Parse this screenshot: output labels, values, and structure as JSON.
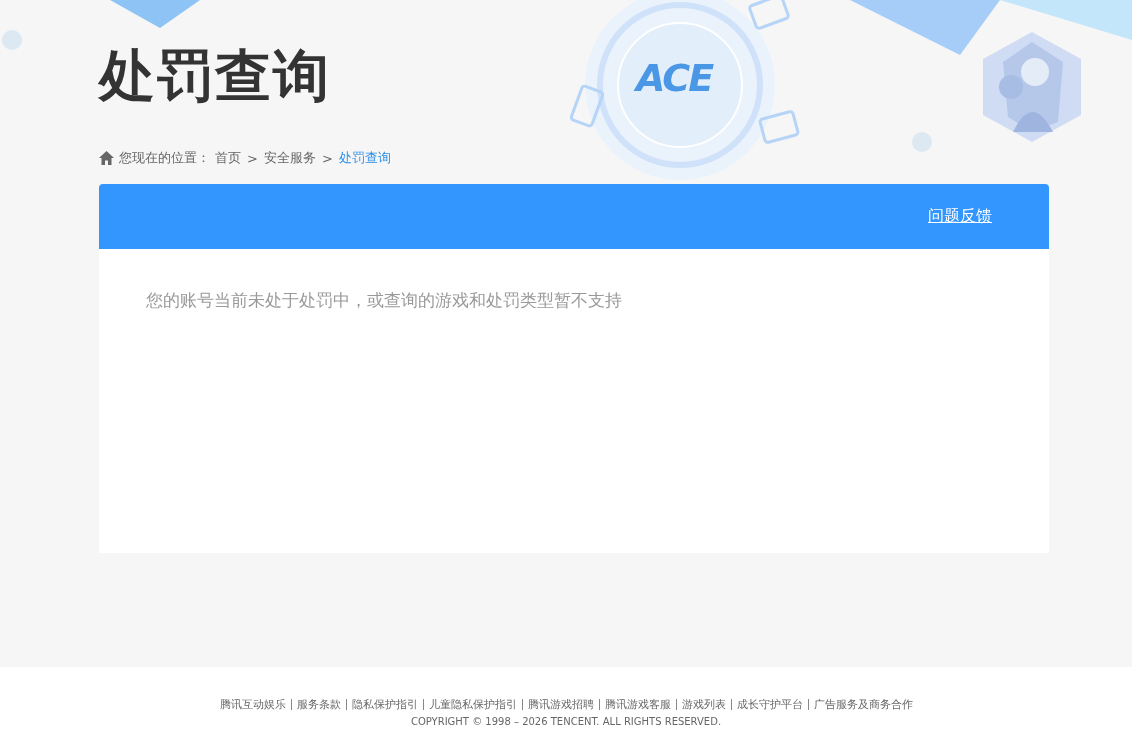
{
  "header": {
    "title": "处罚查询",
    "logo_text": "ACE"
  },
  "breadcrumb": {
    "prefix": "您现在的位置：",
    "items": [
      {
        "label": "首页",
        "selected": false
      },
      {
        "label": "安全服务",
        "selected": false
      },
      {
        "label": "处罚查询",
        "selected": true
      }
    ],
    "separator": ">"
  },
  "panel": {
    "feedback_link": "问题反馈",
    "message": "您的账号当前未处于处罚中，或查询的游戏和处罚类型暂不支持"
  },
  "footer": {
    "links": [
      "腾讯互动娱乐",
      "服务条款",
      "隐私保护指引",
      "儿童隐私保护指引",
      "腾讯游戏招聘",
      "腾讯游戏客服",
      "游戏列表",
      "成长守护平台",
      "广告服务及商务合作"
    ],
    "copyright": "COPYRIGHT © 1998 – 2026 TENCENT. ALL RIGHTS RESERVED."
  }
}
